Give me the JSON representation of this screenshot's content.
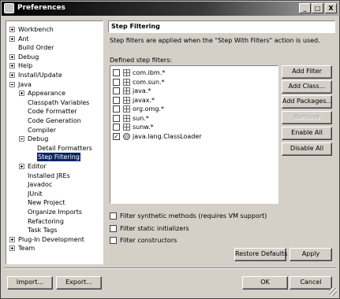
{
  "window": {
    "title": "Preferences",
    "minimize": "_",
    "maximize": "□",
    "close": "X"
  },
  "tree": [
    {
      "label": "Workbench",
      "expander": "closed"
    },
    {
      "label": "Ant",
      "expander": "closed"
    },
    {
      "label": "Build Order",
      "expander": "none"
    },
    {
      "label": "Debug",
      "expander": "closed"
    },
    {
      "label": "Help",
      "expander": "closed"
    },
    {
      "label": "Install/Update",
      "expander": "closed"
    },
    {
      "label": "Java",
      "expander": "open"
    },
    {
      "label": "Appearance",
      "expander": "closed"
    },
    {
      "label": "Classpath Variables",
      "expander": "none"
    },
    {
      "label": "Code Formatter",
      "expander": "none"
    },
    {
      "label": "Code Generation",
      "expander": "none"
    },
    {
      "label": "Compiler",
      "expander": "none"
    },
    {
      "label": "Debug",
      "expander": "open"
    },
    {
      "label": "Detail Formatters",
      "expander": "none"
    },
    {
      "label": "Step Filtering",
      "expander": "none",
      "selected": true
    },
    {
      "label": "Editor",
      "expander": "closed"
    },
    {
      "label": "Installed JREs",
      "expander": "none"
    },
    {
      "label": "Javadoc",
      "expander": "none"
    },
    {
      "label": "JUnit",
      "expander": "none"
    },
    {
      "label": "New Project",
      "expander": "none"
    },
    {
      "label": "Organize Imports",
      "expander": "none"
    },
    {
      "label": "Refactoring",
      "expander": "none"
    },
    {
      "label": "Task Tags",
      "expander": "none"
    },
    {
      "label": "Plug-In Development",
      "expander": "closed"
    },
    {
      "label": "Team",
      "expander": "closed"
    }
  ],
  "page": {
    "title": "Step Filtering",
    "description": "Step filters are applied when the \"Step With Filters\" action is used.",
    "defined_label": "Defined step filters:"
  },
  "filters": [
    {
      "name": "com.ibm.*",
      "checked": false,
      "icon": "package-icon"
    },
    {
      "name": "com.sun.*",
      "checked": false,
      "icon": "package-icon"
    },
    {
      "name": "java.*",
      "checked": false,
      "icon": "package-icon"
    },
    {
      "name": "javax.*",
      "checked": false,
      "icon": "package-icon"
    },
    {
      "name": "org.omg.*",
      "checked": false,
      "icon": "package-icon"
    },
    {
      "name": "sun.*",
      "checked": false,
      "icon": "package-icon"
    },
    {
      "name": "sunw.*",
      "checked": false,
      "icon": "package-icon"
    },
    {
      "name": "java.lang.ClassLoader",
      "checked": true,
      "icon": "class-icon"
    }
  ],
  "side_buttons": {
    "add_filter": "Add Filter",
    "add_class": "Add Class...",
    "add_packages": "Add Packages...",
    "remove": "Remove",
    "enable_all": "Enable All",
    "disable_all": "Disable All"
  },
  "options": {
    "synthetic": "Filter synthetic methods (requires VM support)",
    "static_init": "Filter static initializers",
    "constructors": "Filter constructors"
  },
  "page_buttons": {
    "restore_defaults": "Restore Defaults",
    "apply": "Apply"
  },
  "footer": {
    "import": "Import...",
    "export": "Export...",
    "ok": "OK",
    "cancel": "Cancel"
  },
  "check_mark": "✓"
}
